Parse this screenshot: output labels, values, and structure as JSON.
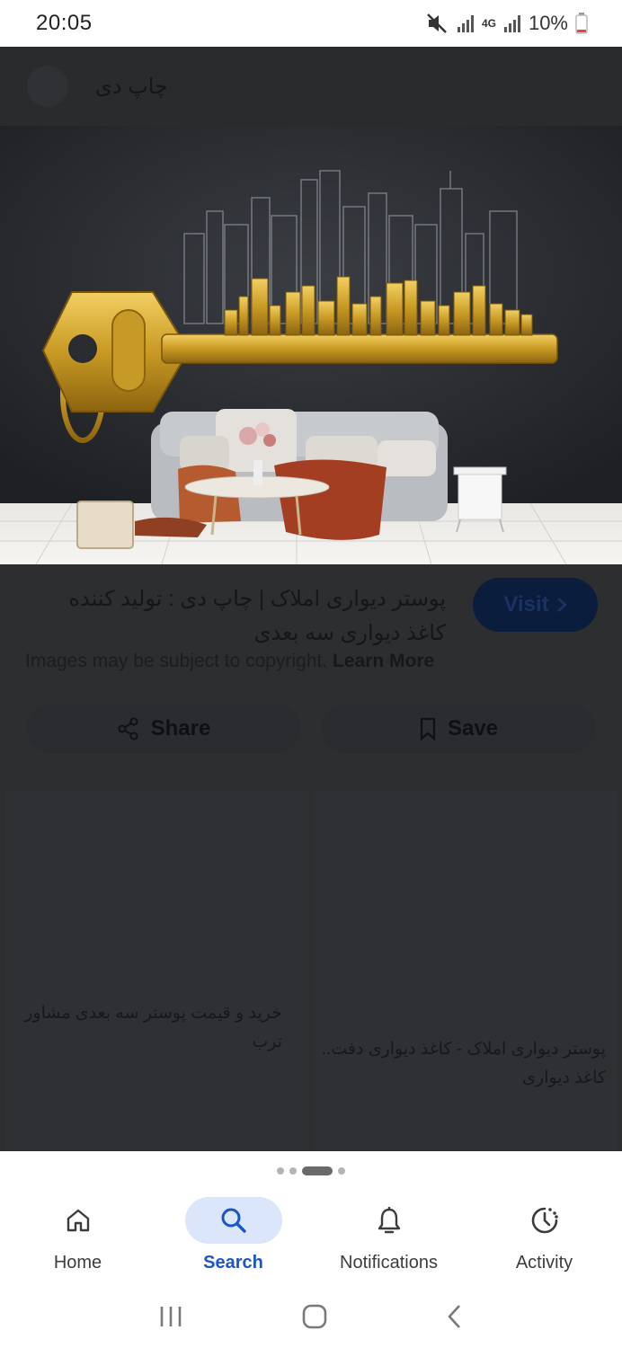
{
  "status_bar": {
    "time": "20:05",
    "network": "4G",
    "battery": "10%",
    "icons": [
      "mute-icon",
      "signal-icon",
      "battery-icon"
    ]
  },
  "header": {
    "site_name": "چاپ دی"
  },
  "result": {
    "title": "پوستر دیواری املاک | چاپ دی : تولید کننده کاغذ دیواری سه بعدی",
    "visit_label": "Visit",
    "copyright_text": "Images may be subject to copyright.",
    "learn_more": "Learn More"
  },
  "actions": {
    "share_label": "Share",
    "save_label": "Save"
  },
  "related": [
    {
      "text": "خرید و قیمت پوستر سه بعدی مشاور ترب"
    },
    {
      "text": "پوستر دیواری املاک - کاغذ دیواری دفت.. کاغذ دیواری"
    }
  ],
  "bottom_nav": {
    "items": [
      {
        "label": "Home",
        "icon": "home-icon"
      },
      {
        "label": "Search",
        "icon": "search-icon"
      },
      {
        "label": "Notifications",
        "icon": "bell-icon"
      },
      {
        "label": "Activity",
        "icon": "activity-icon"
      }
    ],
    "active": "Search"
  },
  "colors": {
    "overlay": "#2d2e30",
    "accent": "#1a56c9",
    "active_pill": "#dce6fb"
  }
}
